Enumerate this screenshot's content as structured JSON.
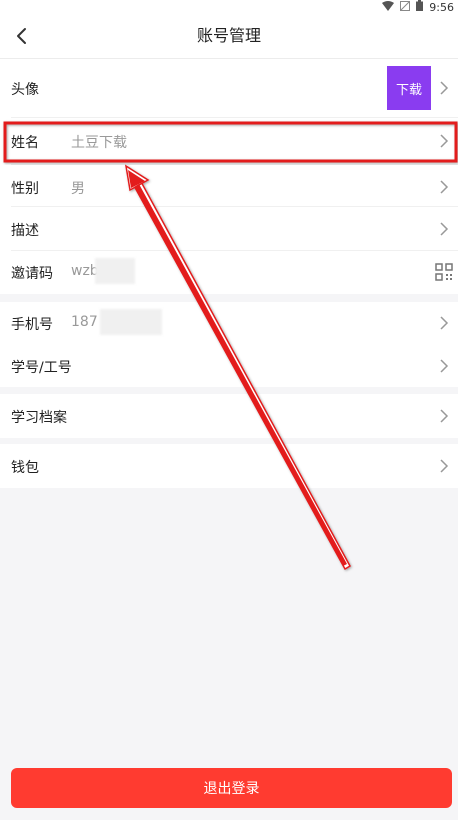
{
  "status": {
    "time": "9:56"
  },
  "header": {
    "title": "账号管理"
  },
  "profile": {
    "avatar": {
      "label": "头像",
      "thumb_text": "下载"
    },
    "name": {
      "label": "姓名",
      "value": "土豆下载"
    },
    "gender": {
      "label": "性别",
      "value": "男"
    },
    "description": {
      "label": "描述",
      "value": ""
    },
    "invite_code": {
      "label": "邀请码",
      "value": "wzb"
    }
  },
  "account": {
    "phone": {
      "label": "手机号",
      "value": "187"
    },
    "student_id": {
      "label": "学号/工号"
    }
  },
  "learning": {
    "label": "学习档案"
  },
  "wallet": {
    "label": "钱包"
  },
  "logout_label": "退出登录",
  "colors": {
    "accent": "#ff3b30",
    "annotation": "#e31e1e",
    "avatar_bg": "#8a3cf0"
  }
}
